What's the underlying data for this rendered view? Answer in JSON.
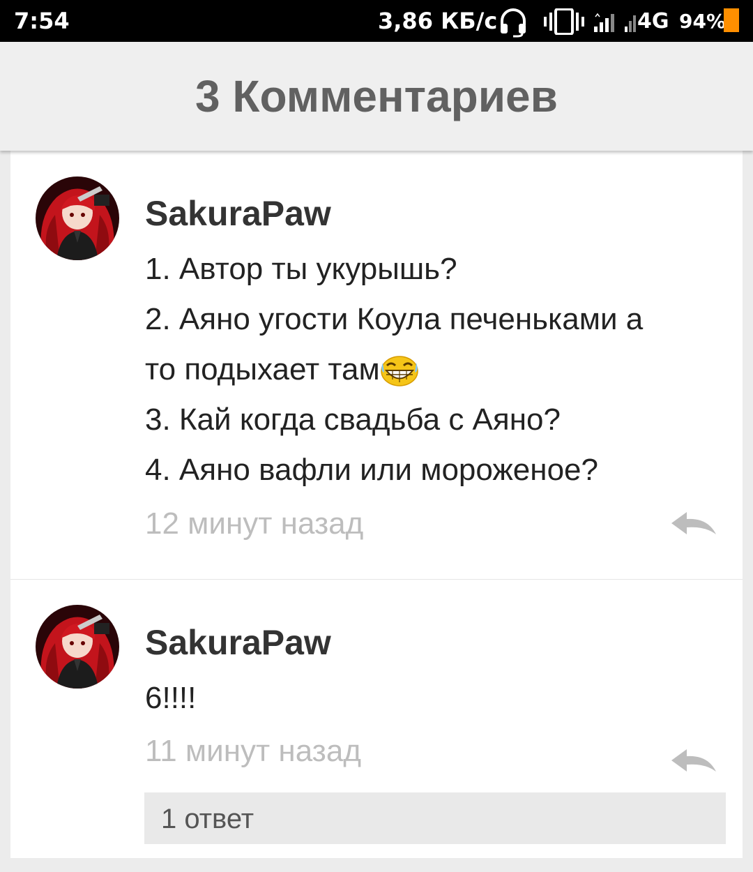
{
  "status_bar": {
    "time": "7:54",
    "network_speed": "3,86 КБ/с",
    "network_type": "4G",
    "battery_percent": "94%",
    "battery_level": 0.94,
    "icons": [
      "headset-icon",
      "vibrate-icon",
      "signal-icon",
      "signal-icon",
      "battery-icon"
    ]
  },
  "header": {
    "title": "3 Комментариев"
  },
  "comments": [
    {
      "username": "SakuraPaw",
      "avatar": "avatar-image",
      "lines": [
        "1. Автор ты укурышь?",
        "2. Аяно угости Коула печеньками а",
        "то подыхает там",
        "3. Кай когда свадьба с Аяно?",
        "4. Аяно вафли или мороженое?"
      ],
      "emoji": "laughing-emoji",
      "time": "12 минут назад",
      "reply_icon": "reply-icon"
    },
    {
      "username": "SakuraPaw",
      "avatar": "avatar-image",
      "lines": [
        "6!!!!"
      ],
      "time": "11 минут назад",
      "reply_icon": "reply-icon",
      "replies_label": "1 ответ"
    }
  ],
  "colors": {
    "status_bar": "#000000",
    "header_bg": "#efefef",
    "header_text": "#616161",
    "page_bg": "#ececec",
    "card_bg": "#ffffff",
    "timestamp": "#bdbdbd",
    "battery": "#ff8f00"
  }
}
